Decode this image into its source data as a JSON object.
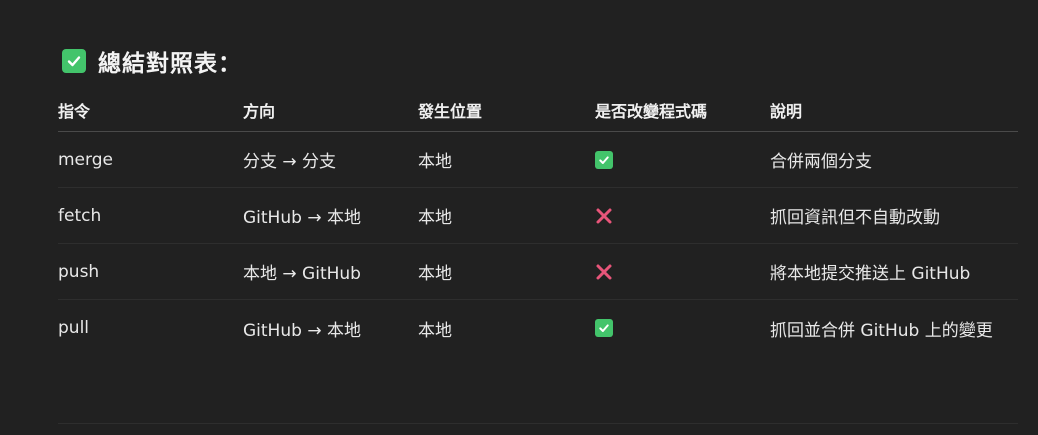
{
  "heading": {
    "icon": "check-mark-button-icon",
    "text": "總結對照表："
  },
  "table": {
    "headers": [
      "指令",
      "方向",
      "發生位置",
      "是否改變程式碼",
      "說明"
    ],
    "rows": [
      {
        "command": "merge",
        "direction": "分支 → 分支",
        "location": "本地",
        "changes_code": "check-icon",
        "description": "合併兩個分支"
      },
      {
        "command": "fetch",
        "direction": "GitHub → 本地",
        "location": "本地",
        "changes_code": "cross-icon",
        "description": "抓回資訊但不自動改動"
      },
      {
        "command": "push",
        "direction": "本地 → GitHub",
        "location": "本地",
        "changes_code": "cross-icon",
        "description": "將本地提交推送上 GitHub"
      },
      {
        "command": "pull",
        "direction": "GitHub → 本地",
        "location": "本地",
        "changes_code": "check-icon",
        "description": "抓回並合併 GitHub 上的變更"
      }
    ]
  },
  "colors": {
    "background": "#212121",
    "check": "#43c46b",
    "cross": "#e8557a"
  }
}
